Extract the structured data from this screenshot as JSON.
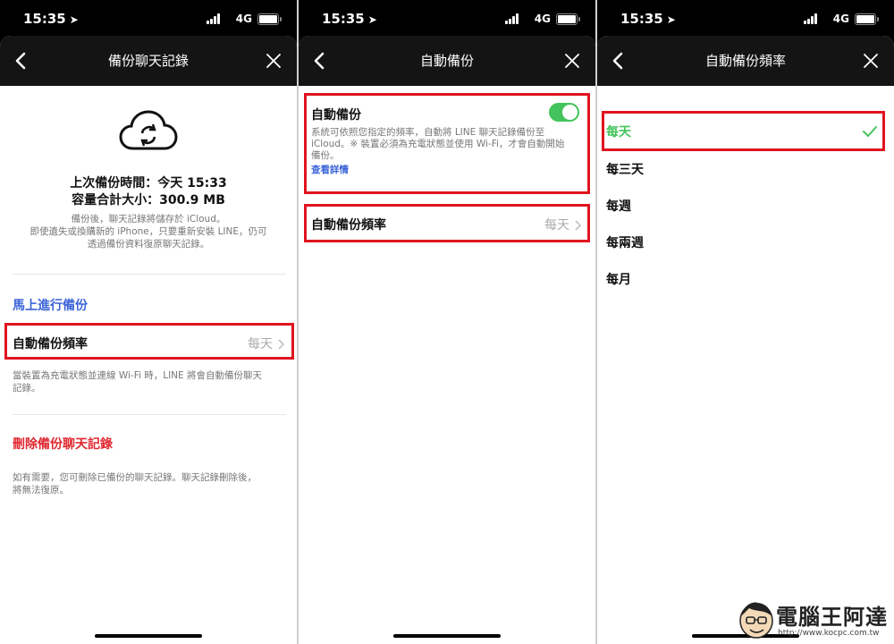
{
  "status_bar": {
    "time": "15:35",
    "network": "4G"
  },
  "screen1": {
    "title": "備份聊天記錄",
    "last_backup": "上次備份時間：今天 15:33",
    "total_size": "容量合計大小：300.9 MB",
    "desc": [
      "備份後，聊天記錄將儲存於 iCloud。",
      "即使遺失或換購新的 iPhone，只要重新安裝 LINE，仍可",
      "透過備份資料復原聊天記錄。"
    ],
    "backup_now": "馬上進行備份",
    "freq_label": "自動備份頻率",
    "freq_value": "每天",
    "freq_note": [
      "當裝置為充電狀態並連線 Wi-Fi 時，LINE 將會自動備份聊天",
      "記錄。"
    ],
    "delete_label": "刪除備份聊天記錄",
    "delete_note": [
      "如有需要，您可刪除已備份的聊天記錄。聊天記錄刪除後，",
      "將無法復原。"
    ]
  },
  "screen2": {
    "title": "自動備份",
    "auto_label": "自動備份",
    "auto_desc": [
      "系統可依照您指定的頻率，自動將 LINE 聊天記錄備份至",
      "iCloud。※ 裝置必須為充電狀態並使用 Wi-Fi，才會自動開始",
      "備份。"
    ],
    "details_link": "查看詳情",
    "toggle_on": true,
    "freq_label": "自動備份頻率",
    "freq_value": "每天"
  },
  "screen3": {
    "title": "自動備份頻率",
    "options": [
      "每天",
      "每三天",
      "每週",
      "每兩週",
      "每月"
    ],
    "selected_index": 0
  },
  "watermark": {
    "text": "電腦王阿達",
    "url": "http://www.kocpc.com.tw"
  },
  "colors": {
    "accent_green": "#43c35b",
    "link_blue": "#3b64d8",
    "danger_red": "#e0272f",
    "highlight_red": "#e0141e"
  }
}
